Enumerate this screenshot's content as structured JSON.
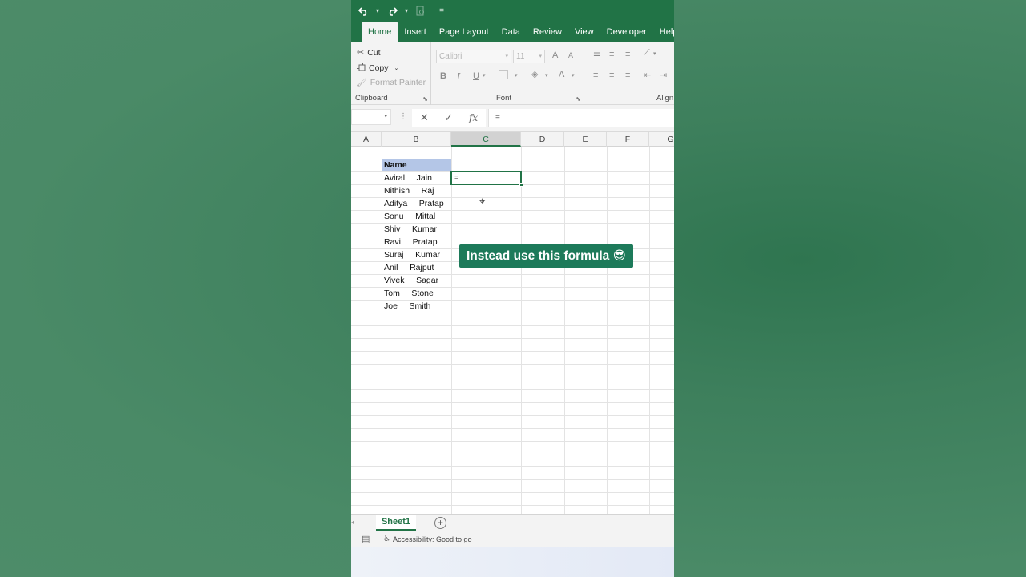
{
  "quick_access": {
    "undo_icon": "undo-icon",
    "redo_icon": "redo-icon",
    "customize_label": "="
  },
  "tabs": [
    {
      "label": "Home",
      "active": true
    },
    {
      "label": "Insert"
    },
    {
      "label": "Page Layout"
    },
    {
      "label": "Data"
    },
    {
      "label": "Review"
    },
    {
      "label": "View"
    },
    {
      "label": "Developer"
    },
    {
      "label": "Help"
    }
  ],
  "ribbon": {
    "clipboard": {
      "cut": "Cut",
      "copy": "Copy",
      "format_painter": "Format Painter",
      "label": "Clipboard"
    },
    "font": {
      "font_name": "Calibri",
      "font_size": "11",
      "bold": "B",
      "italic": "I",
      "underline": "U",
      "font_color": "A",
      "grow": "A",
      "shrink": "A",
      "label": "Font"
    },
    "alignment": {
      "label": "Align"
    }
  },
  "formula_bar": {
    "name_box": "",
    "content": "="
  },
  "columns": [
    "A",
    "B",
    "C",
    "D",
    "E",
    "F",
    "G"
  ],
  "selected_column": "C",
  "sheet": {
    "header": "Name",
    "names": [
      "Aviral     Jain",
      "Nithish     Raj",
      "Aditya     Pratap",
      "Sonu     Mittal",
      "Shiv     Kumar",
      "Ravi     Pratap",
      "Suraj     Kumar",
      "Anil     Rajput",
      "Vivek     Sagar",
      "Tom     Stone",
      "Joe     Smith"
    ],
    "active_cell_value": "="
  },
  "overlay": {
    "caption": "Instead use this formula 😎"
  },
  "sheet_tabs": [
    {
      "label": "Sheet1",
      "active": true
    }
  ],
  "status": {
    "accessibility": "Accessibility: Good to go"
  },
  "colors": {
    "excel_green": "#217346",
    "header_fill": "#b4c6e7",
    "caption_bg": "#1d7a5a",
    "page_bg": "#4a8a67"
  }
}
